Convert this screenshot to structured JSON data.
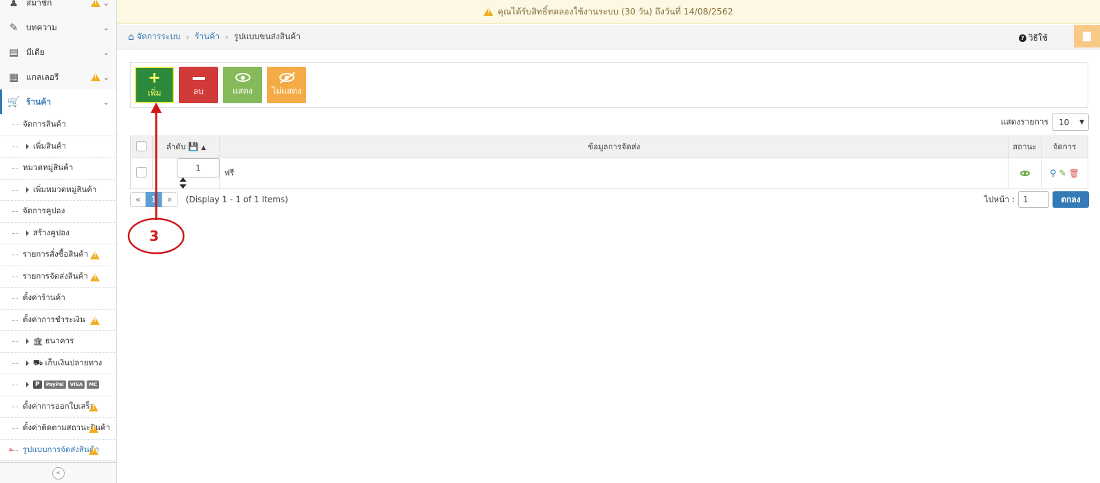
{
  "notice": {
    "text": "คุณได้รับสิทธิ์ทดลองใช้งานระบบ (30 วัน) ถึงวันที่ 14/08/2562"
  },
  "sidebar": {
    "menu": [
      {
        "label": "สมาชิก",
        "icon": "user-icon",
        "warn": true
      },
      {
        "label": "บทความ",
        "icon": "edit-icon",
        "warn": false
      },
      {
        "label": "มีเดีย",
        "icon": "film-icon",
        "warn": false
      },
      {
        "label": "แกลเลอรี",
        "icon": "grid-icon",
        "warn": true
      },
      {
        "label": "ร้านค้า",
        "icon": "cart-icon",
        "warn": false,
        "active": true
      }
    ],
    "sub": [
      {
        "label": "จัดการสินค้า"
      },
      {
        "label": "เพิ่มสินค้า",
        "child": true
      },
      {
        "label": "หมวดหมู่สินค้า"
      },
      {
        "label": "เพิ่มหมวดหมู่สินค้า",
        "child": true
      },
      {
        "label": "จัดการคูปอง"
      },
      {
        "label": "สร้างคูปอง",
        "child": true
      },
      {
        "label": "รายการสั่งซื้อสินค้า",
        "warn": true
      },
      {
        "label": "รายการจัดส่งสินค้า",
        "warn": true
      },
      {
        "label": "ตั้งค่าร้านค้า"
      },
      {
        "label": "ตั้งค่าการชำระเงิน",
        "warn": true
      },
      {
        "label": "ธนาคาร",
        "child": true,
        "icon": "bank-icon"
      },
      {
        "label": "เก็บเงินปลายทาง",
        "child": true,
        "icon": "truck-icon"
      },
      {
        "label": "",
        "child": true,
        "payment": [
          "PayPal",
          "VISA",
          "MC"
        ]
      },
      {
        "label": "ตั้งค่าการออกใบเสร็จ",
        "warn": true
      },
      {
        "label": "ตั้งค่าติดตามสถานะสินค้า",
        "warn": true
      },
      {
        "label": "รูปแบบการจัดส่งสินค้า",
        "warn": true,
        "current": true
      }
    ]
  },
  "breadcrumb": {
    "items": [
      "จัดการระบบ",
      "ร้านค้า"
    ],
    "current": "รูปแบบขนส่งสินค้า",
    "help": "วิธีใช้"
  },
  "toolbar": {
    "add": "เพิ่ม",
    "delete": "ลบ",
    "show": "แสดง",
    "hide": "ไม่แสดง"
  },
  "table": {
    "show_entries_label": "แสดงรายการ",
    "show_entries_value": "10",
    "headers": {
      "order": "ลำดับ",
      "info": "ข้อมูลการจัดส่ง",
      "status": "สถานะ",
      "manage": "จัดการ"
    },
    "rows": [
      {
        "order": "1",
        "info": "ฟรี"
      }
    ]
  },
  "pagination": {
    "prev": "«",
    "page": "1",
    "next": "»",
    "info": "(Display 1 - 1 of 1 Items)",
    "goto_label": "ไปหน้า :",
    "goto_value": "1",
    "goto_button": "ตกลง"
  },
  "annotation": {
    "number": "3",
    "color": "#d01818"
  }
}
